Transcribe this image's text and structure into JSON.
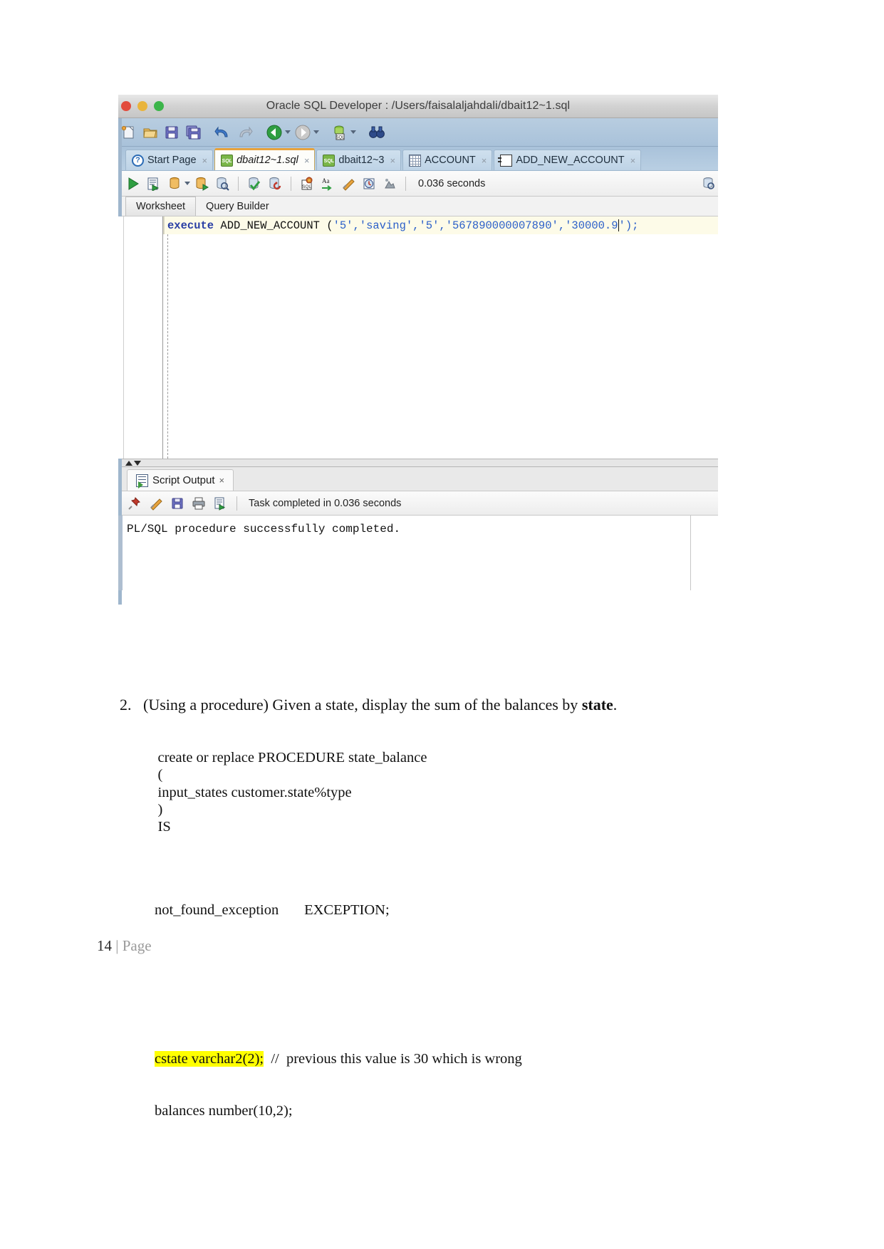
{
  "screenshot": {
    "window_title": "Oracle SQL Developer : /Users/faisalaljahdali/dbait12~1.sql",
    "traffic_lights": [
      "close",
      "minimize",
      "maximize"
    ],
    "main_toolbar": {
      "icons": [
        "new-file-icon",
        "open-folder-icon",
        "save-icon",
        "save-all-icon",
        "undo-icon",
        "redo-icon",
        "back-navigate-icon",
        "forward-navigate-icon",
        "sql-history-icon",
        "find-binoculars-icon"
      ]
    },
    "tabs": [
      {
        "label": "Start Page",
        "icon": "help-question-icon",
        "active": false,
        "closable": true
      },
      {
        "label": "dbait12~1.sql",
        "icon": "sql-worksheet-icon",
        "active": true,
        "closable": true
      },
      {
        "label": "dbait12~3",
        "icon": "sql-worksheet-icon",
        "active": false,
        "closable": true
      },
      {
        "label": "ACCOUNT",
        "icon": "table-grid-icon",
        "active": false,
        "closable": true
      },
      {
        "label": "ADD_NEW_ACCOUNT",
        "icon": "procedure-icon",
        "active": false,
        "closable": true
      }
    ],
    "worksheet_toolbar": {
      "icons": [
        "run-statement-icon",
        "run-script-icon",
        "explain-plan-icon",
        "dropdown-caret-icon",
        "autotrace-icon",
        "sql-tuning-icon",
        "commit-icon",
        "rollback-icon",
        "compile-icon",
        "format-aa-icon",
        "clear-eraser-icon",
        "history-clock-icon",
        "query-builder-icon"
      ],
      "elapsed": "0.036 seconds"
    },
    "sub_tabs": [
      {
        "label": "Worksheet",
        "selected": true
      },
      {
        "label": "Query Builder",
        "selected": false
      }
    ],
    "editor": {
      "code": {
        "keyword": "execute",
        "procedure": " ADD_NEW_ACCOUNT (",
        "args": "'5','saving','5','567890000007890','30000.9",
        "tail": "');"
      }
    },
    "script_output": {
      "tab_label": "Script Output",
      "tab_icon": "script-output-icon",
      "toolbar_icons": [
        "pin-icon",
        "clear-eraser-icon",
        "save-icon",
        "print-icon",
        "open-in-editor-icon"
      ],
      "status": "Task completed in 0.036 seconds",
      "body": "PL/SQL procedure successfully completed."
    }
  },
  "document": {
    "question": {
      "number": "2.",
      "text_before": "(Using a procedure) Given a state, display the sum of the balances by ",
      "bold_word": "state",
      "text_after": "."
    },
    "code_lines": {
      "l1": "create or replace PROCEDURE state_balance",
      "l2": "(",
      "l3": "input_states customer.state%type",
      "l4": ")",
      "l5": "IS",
      "l6": "not_found_exception       EXCEPTION;",
      "l7_highlight": "cstate varchar2(2);",
      "l7_rest": "  //  previous this value is 30 which is wrong",
      "l8": "balances number(10,2);"
    },
    "footer": {
      "page_number": "14",
      "separator": " | ",
      "label": "Page"
    }
  },
  "colors": {
    "highlight": "#ffff00",
    "keyword": "#2a3fa5",
    "string": "#2b5fc9",
    "accent_tab": "#e8a33d"
  }
}
